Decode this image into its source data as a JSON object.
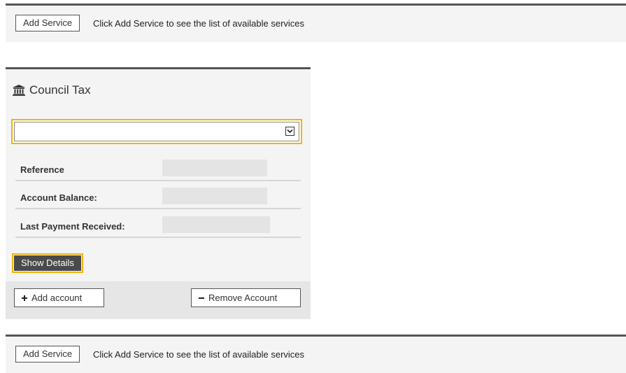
{
  "top_bar": {
    "button_label": "Add Service",
    "hint": "Click Add Service to see the list of available services"
  },
  "card": {
    "icon": "bank-icon",
    "title": "Council Tax",
    "select_value": "",
    "rows": [
      {
        "label": "Reference",
        "value": ""
      },
      {
        "label": "Account Balance:",
        "value": ""
      },
      {
        "label": "Last Payment Received:",
        "value": ""
      }
    ],
    "show_details_label": "Show Details",
    "add_account": {
      "icon": "plus-icon",
      "label": "Add account"
    },
    "remove_account": {
      "icon": "minus-icon",
      "label": "Remove Account"
    },
    "colors": {
      "focus_outline": "#f0b400",
      "dark_button": "#4a4a4a"
    }
  },
  "bottom_bar": {
    "button_label": "Add Service",
    "hint": "Click Add Service to see the list of available services"
  }
}
